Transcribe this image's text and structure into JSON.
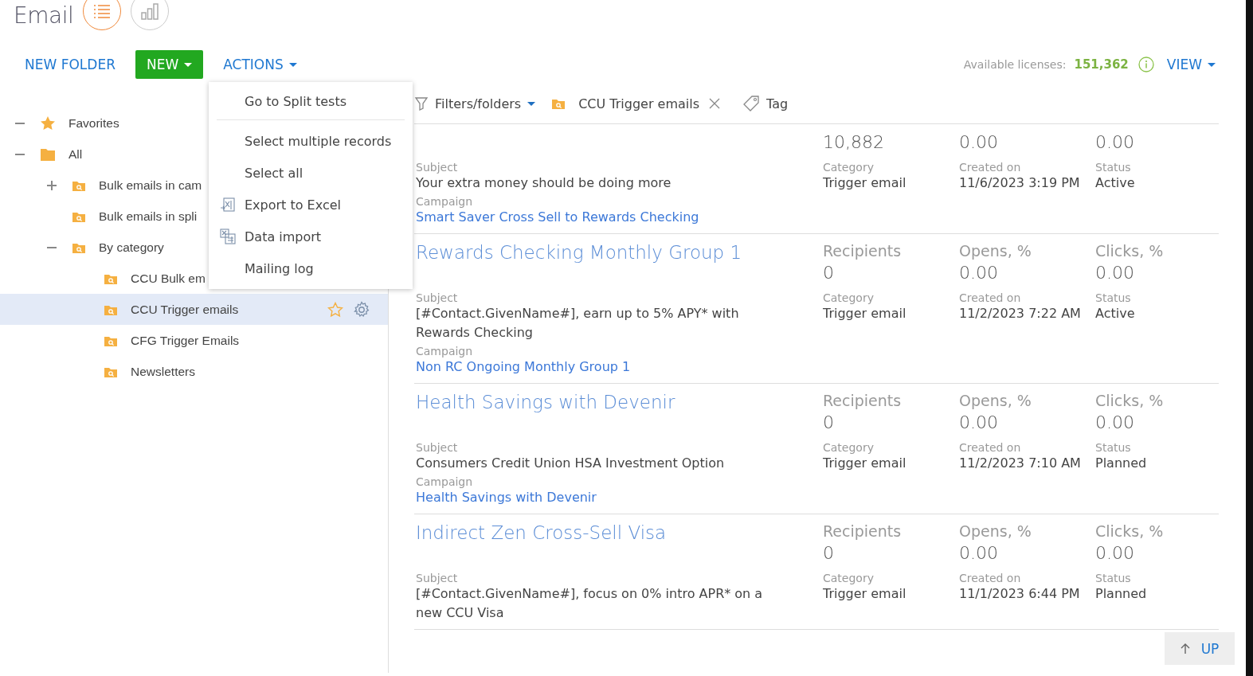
{
  "header": {
    "title": "Email",
    "views": [
      {
        "kind": "list",
        "selected": true
      },
      {
        "kind": "chart",
        "selected": false
      }
    ]
  },
  "toolbar": {
    "new_folder": "NEW FOLDER",
    "new": "NEW",
    "actions": "ACTIONS",
    "licenses_label": "Available licenses:",
    "licenses": "151,362",
    "view": "VIEW"
  },
  "actions_menu": [
    {
      "label": "Go to Split tests",
      "kind": "plain",
      "divider_after": true
    },
    {
      "label": "Select multiple records",
      "kind": "plain",
      "divider_after": false
    },
    {
      "label": "Select all",
      "kind": "plain",
      "divider_after": false
    },
    {
      "label": "Export to Excel",
      "kind": "export",
      "divider_after": false
    },
    {
      "label": "Data import",
      "kind": "import",
      "divider_after": false
    },
    {
      "label": "Mailing log",
      "kind": "plain",
      "divider_after": false
    }
  ],
  "sidebar": {
    "tree": [
      {
        "label": "Favorites",
        "kind": "favorites",
        "expanded": true,
        "selected": false
      },
      {
        "label": "All",
        "kind": "root",
        "expanded": true,
        "selected": false,
        "children": [
          {
            "label": "Bulk emails in cam",
            "kind": "folder",
            "expanded": false,
            "selected": false
          },
          {
            "label": "Bulk emails in spli",
            "kind": "folder",
            "selected": false
          },
          {
            "label": "By category",
            "kind": "folder",
            "expanded": true,
            "selected": false,
            "children": [
              {
                "label": "CCU Bulk em",
                "kind": "folder",
                "selected": false
              },
              {
                "label": "CCU Trigger emails",
                "kind": "folder",
                "selected": true
              },
              {
                "label": "CFG Trigger Emails",
                "kind": "folder",
                "selected": false
              },
              {
                "label": "Newsletters",
                "kind": "folder",
                "selected": false
              }
            ]
          }
        ]
      }
    ]
  },
  "filters": {
    "filters_label": "Filters/folders",
    "folder": "CCU Trigger emails",
    "tag": "Tag"
  },
  "records": [
    {
      "metrics": [
        {
          "value": "10,882"
        },
        {
          "value": "0.00"
        },
        {
          "value": "0.00"
        }
      ],
      "subject_label": "Subject",
      "subject": "Your extra money should be doing more",
      "details": [
        {
          "label": "Category",
          "value": "Trigger email"
        },
        {
          "label": "Created on",
          "value": "11/6/2023 3:19 PM"
        },
        {
          "label": "Status",
          "value": "Active"
        }
      ],
      "campaign_label": "Campaign",
      "campaign": "Smart Saver Cross Sell to Rewards Checking"
    },
    {
      "title": "Rewards Checking Monthly Group 1",
      "metrics": [
        {
          "label": "Recipients",
          "value": "0"
        },
        {
          "label": "Opens, %",
          "value": "0.00"
        },
        {
          "label": "Clicks, %",
          "value": "0.00"
        }
      ],
      "subject_label": "Subject",
      "subject": "[#Contact.GivenName#], earn up to 5% APY* with Rewards Checking",
      "details": [
        {
          "label": "Category",
          "value": "Trigger email"
        },
        {
          "label": "Created on",
          "value": "11/2/2023 7:22 AM"
        },
        {
          "label": "Status",
          "value": "Active"
        }
      ],
      "campaign_label": "Campaign",
      "campaign": "Non RC Ongoing Monthly Group 1"
    },
    {
      "title": "Health Savings with Devenir",
      "metrics": [
        {
          "label": "Recipients",
          "value": "0"
        },
        {
          "label": "Opens, %",
          "value": "0.00"
        },
        {
          "label": "Clicks, %",
          "value": "0.00"
        }
      ],
      "subject_label": "Subject",
      "subject": "Consumers Credit Union HSA Investment Option",
      "details": [
        {
          "label": "Category",
          "value": "Trigger email"
        },
        {
          "label": "Created on",
          "value": "11/2/2023 7:10 AM"
        },
        {
          "label": "Status",
          "value": "Planned"
        }
      ],
      "campaign_label": "Campaign",
      "campaign": "Health Savings with Devenir"
    },
    {
      "title": "Indirect Zen Cross-Sell Visa",
      "metrics": [
        {
          "label": "Recipients",
          "value": "0"
        },
        {
          "label": "Opens, %",
          "value": "0.00"
        },
        {
          "label": "Clicks, %",
          "value": "0.00"
        }
      ],
      "subject_label": "Subject",
      "subject": "[#Contact.GivenName#], focus on 0% intro APR* on a new CCU Visa",
      "details": [
        {
          "label": "Category",
          "value": "Trigger email"
        },
        {
          "label": "Created on",
          "value": "11/1/2023 6:44 PM"
        },
        {
          "label": "Status",
          "value": "Planned"
        }
      ]
    }
  ],
  "up_button": "UP"
}
